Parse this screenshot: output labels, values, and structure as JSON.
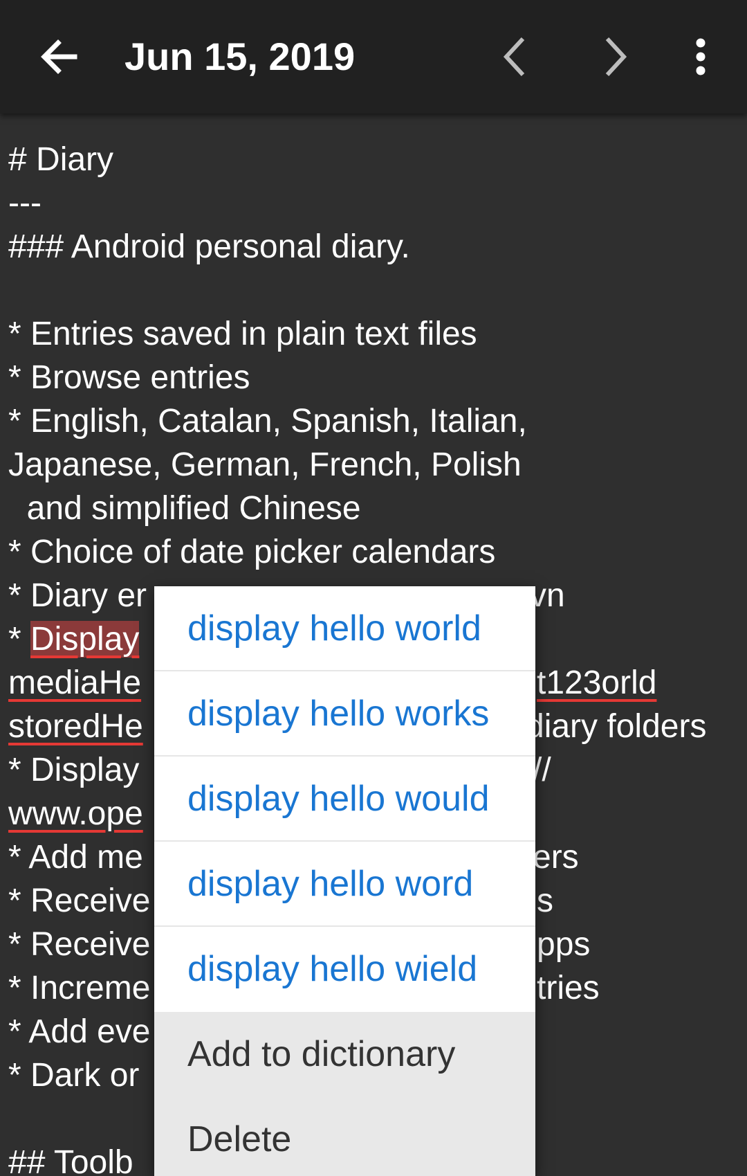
{
  "toolbar": {
    "title": "Jun 15, 2019",
    "back_icon": "arrow-left-icon",
    "prev_icon": "chevron-left-icon",
    "next_icon": "chevron-right-icon",
    "menu_icon": "more-vert-icon"
  },
  "editor": {
    "lines": [
      "# Diary",
      "---",
      "### Android personal diary.",
      "",
      "* Entries saved in plain text files",
      "* Browse entries",
      "* English, Catalan, Spanish, Italian,",
      "Japanese, German, French, Polish",
      "  and simplified Chinese",
      "* Choice of date picker calendars",
      "* Diary er",
      "* ",
      "mediaHe",
      "storedHe",
      "* Display",
      "www.ope",
      "* Add me",
      "* Receive",
      "* Receive",
      "* Increme",
      "* Add eve",
      "* Dark or",
      "",
      "## Toolb"
    ],
    "selected_word": "Display",
    "right_fragments": {
      "line10": "vn",
      "line12": "t123orld",
      "line13": "diary folders",
      "line14": "//",
      "line16": "ers",
      "line17": "s",
      "line18": "pps",
      "line19": "tries"
    }
  },
  "popup": {
    "suggestions": [
      "display hello world",
      "display hello works",
      "display hello would",
      "display hello word",
      "display hello wield"
    ],
    "actions": {
      "add_to_dictionary": "Add to dictionary",
      "delete": "Delete"
    }
  },
  "colors": {
    "toolbar_bg": "#212121",
    "editor_bg": "#2f2f2f",
    "text": "#ffffff",
    "suggestion_text": "#1976d2",
    "spell_underline": "#e53935",
    "selection": "#8b3a3a"
  }
}
